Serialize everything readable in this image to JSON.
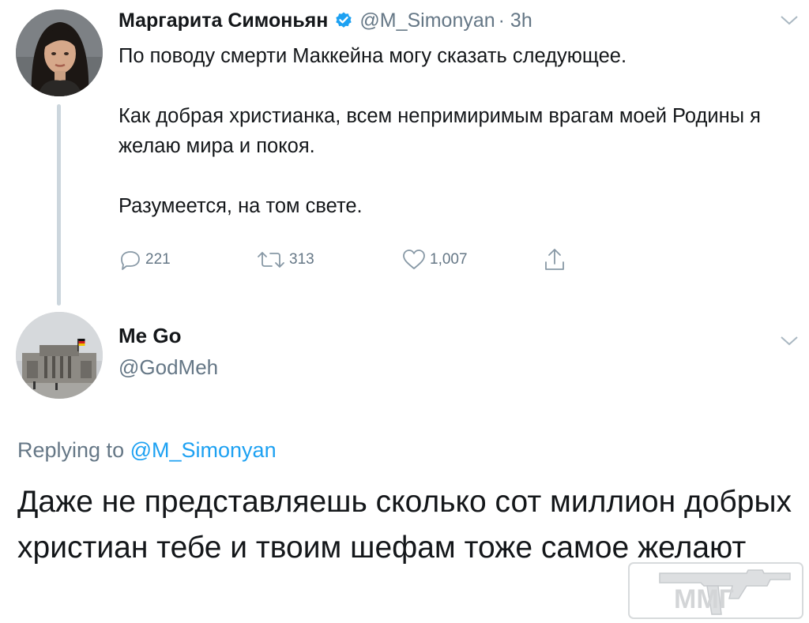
{
  "tweet": {
    "author": {
      "display_name": "Маргарита Симоньян",
      "handle": "@M_Simonyan",
      "time": "· 3h",
      "verified": true
    },
    "paragraphs": [
      "По поводу смерти Маккейна могу сказать следующее.",
      "Как добрая христианка, всем непримиримым врагам моей Родины я желаю мира и покоя.",
      "Разумеется, на том свете."
    ],
    "actions": {
      "reply_count": "221",
      "retweet_count": "313",
      "like_count": "1,007"
    }
  },
  "reply": {
    "author": {
      "display_name": "Me Go",
      "handle": "@GodMeh"
    },
    "replying_to_label": "Replying to",
    "replying_to_handle": "@M_Simonyan",
    "text": "Даже не представляешь сколько сот миллион добрых христиан тебе и твоим шефам тоже самое желают"
  },
  "watermark": {
    "text": "ММГ"
  },
  "colors": {
    "text": "#14171a",
    "secondary": "#657786",
    "link": "#1da1f2",
    "verified": "#1da1f2",
    "thread_line": "#ccd6dd"
  },
  "icons": [
    "verified-badge-icon",
    "chevron-down-icon",
    "reply-icon",
    "retweet-icon",
    "like-icon",
    "share-icon",
    "rifle-icon"
  ]
}
